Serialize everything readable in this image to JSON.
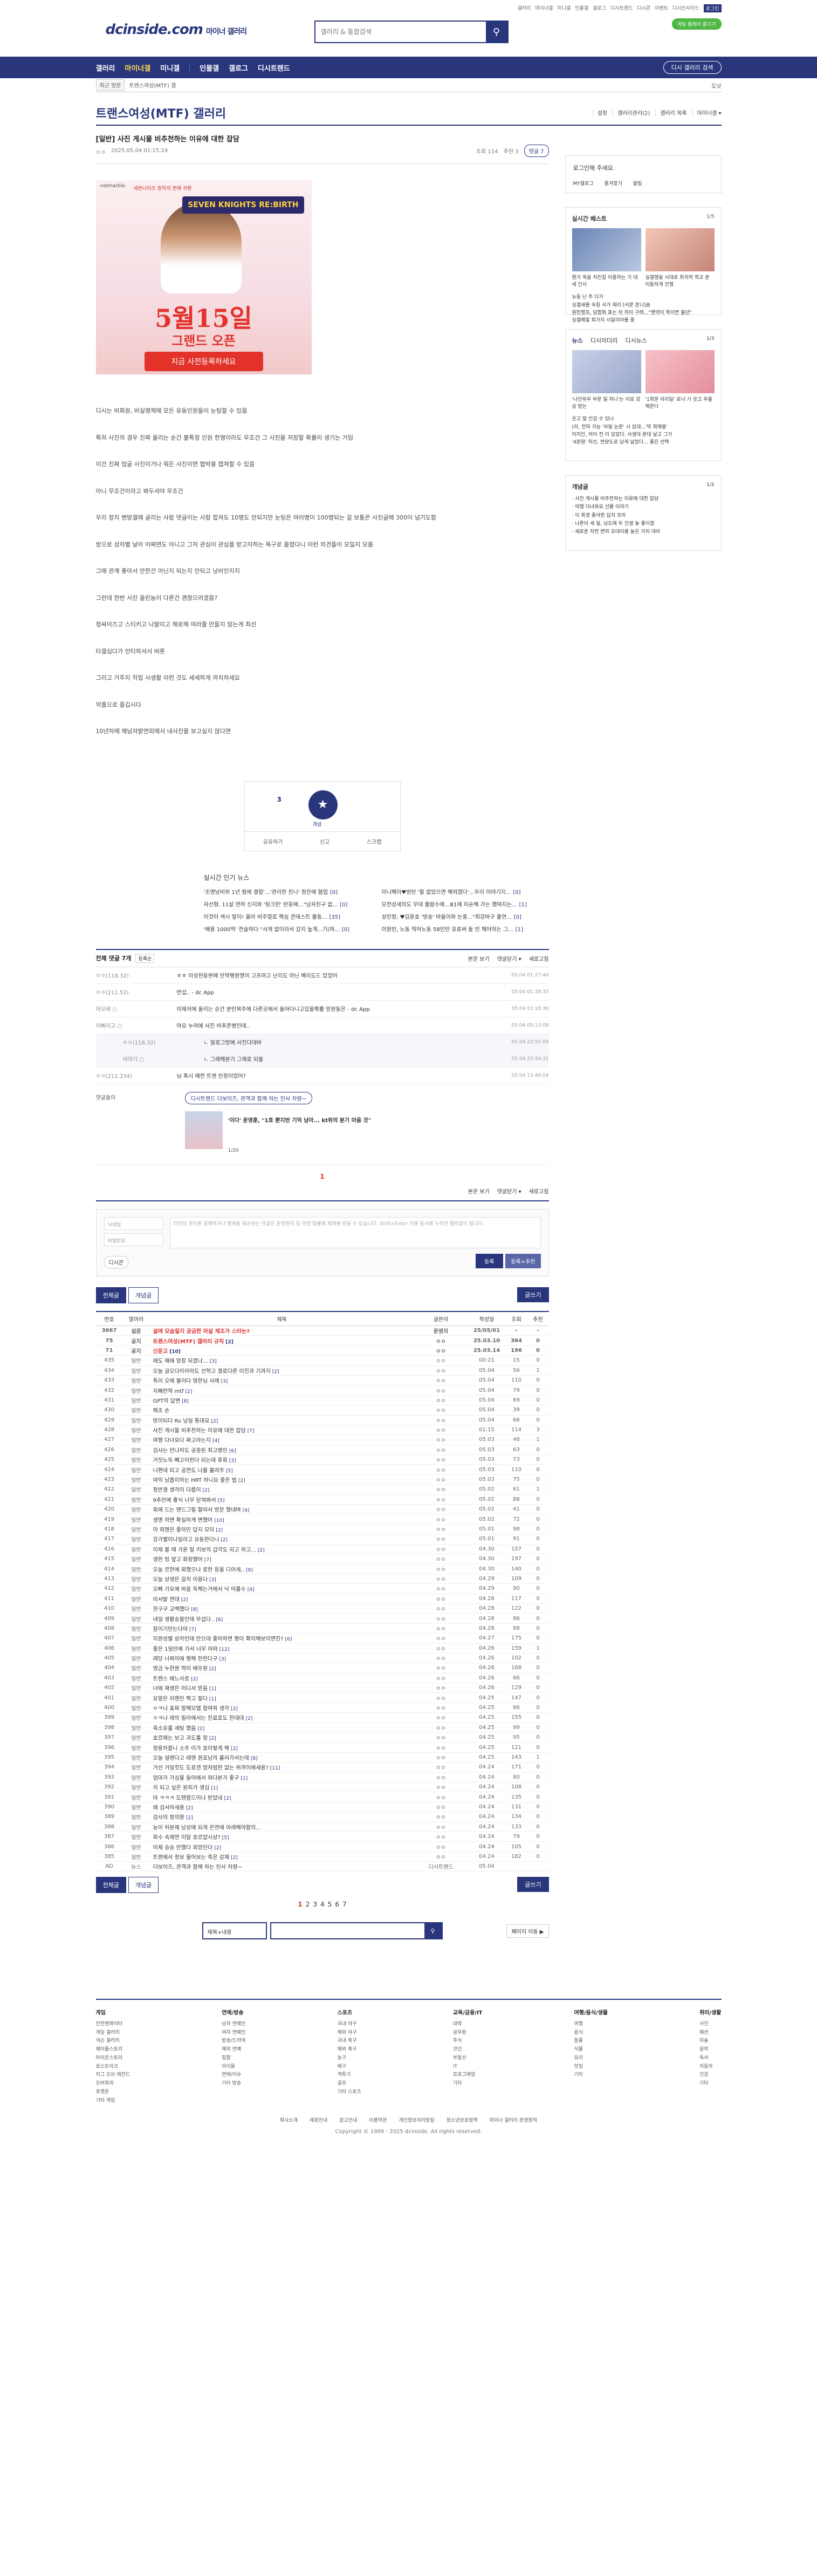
{
  "logo": {
    "main": "dcinside.com",
    "sub": "마이너 갤러리"
  },
  "search": {
    "placeholder": "갤러리 & 통합검색"
  },
  "toplinks": [
    "갤러리",
    "마이너갤",
    "미니갤",
    "인물갤",
    "갤로그",
    "디시트렌드",
    "디시콘",
    "이벤트",
    "디시인사이드",
    "로그인"
  ],
  "topbutton": "게임 플레이 즐기기",
  "gnb": {
    "items": [
      "갤러리",
      "마이너갤",
      "미니갤",
      "인물갤",
      "갤로그",
      "디시트렌드"
    ],
    "search": "디시 갤러리 검색"
  },
  "subbar": {
    "recent": "최근 방문",
    "path": "트랜스여성(MTF) 갤",
    "right": "도넛"
  },
  "gallery": {
    "title": "트랜스여성(MTF) 갤러리",
    "tools": [
      "설정",
      "갤러리관리(2)",
      "갤러리 목록",
      "마이너갤 ▾"
    ]
  },
  "post": {
    "title": "[일반] 사진 게시물 비추천하는 이유에 대한 잡담",
    "author": "ㅇㅇ",
    "date": "2025.05.04 01:15:24",
    "views": "조회 114",
    "recommend": "추천 3",
    "comment_btn": "댓글 7",
    "paragraphs": [
      "디시는 비회원, 비실명제에 모든 유동인원들이 눈팅할 수 있음",
      "특히 사진의 경우 진짜 올리는 순간 불특정 인원 한명이라도 무조건 그 사진을 저장할 확률이 생기는 거임",
      "이건 진짜 엄굴 사진이거나 뭐든 사진이면 협박용 캡쳐할 수 있음",
      "아니 무조건이라고 봐두셔야 무조건",
      "우리 정치 밴방갤에 굴리는 사람 댓글이는 사람 합쳐도 10명도 안되지만 눈팅은 여러명이 100명되는 걸 보통은 사진글에 300이 넘기도함",
      "방으로 성차별 날아 어쩌면도 아니고 그저 관심이 관심을 받고자하는 욕구로 올렸다니 이런 의견들이 모일지 모름",
      "그에 관계 좋아서 안한건 아닌지 되는지 안되고 낭비인지지",
      "그런데 한번 사진 올린놈이 다른건 괜찮으려겠음?",
      "정싸이즈고 스티커고 나발이고 해로해 여러줄 만들지 않는게 최선",
      "타갤심다가 안티하셔서 버릇",
      "그리고 거주지 직업 사생활 이런 것도 세세하게 까치하세요",
      "악플으로 즐깁시다",
      "10년차에 왜남자밝연외에서 내사진을 보고싶지 않다면"
    ],
    "ad": {
      "brand": "netmarble",
      "tag": "세븐나이츠 원작의 판에 귀환",
      "logo": "SEVEN KNIGHTS RE:BIRTH",
      "date": "5월15일",
      "open": "그랜드 오픈",
      "cta": "지금 사전등록하세요"
    },
    "vote": {
      "up": "3",
      "label": "개념",
      "actions": [
        "공유하기",
        "신고",
        "스크랩"
      ]
    }
  },
  "popular": {
    "title": "실시간 인기 뉴스",
    "items": [
      {
        "t": "'조명남비위 1년 줬에 결합'…'관리한 친니' 정은에 혐업",
        "c": "0"
      },
      {
        "t": "미니해미♥방탄 '할 없었으면 해외였다'…우리 이야기지...",
        "c": "0"
      },
      {
        "t": "자산형, 11살 연하 신지와 '링크한' 반응에…\"남자친구 없...",
        "c": "0"
      },
      {
        "t": "모전성세의도 무대 출람수에…B1에 미순해 가는 했여지는...",
        "c": "1"
      },
      {
        "t": "이것이 색시 발이! 옳아 비주얼로 핵심 콘테스트 출동...",
        "c": "35"
      },
      {
        "t": "성민정, ♥김윤호 '방송' 바둘이와 논풍...\"최강바구 출연...",
        "c": "0"
      },
      {
        "t": "'배용 1000억' 전술하다 \"사게 없이라서 갔지 높게...기(파...",
        "c": "0"
      },
      {
        "t": "이원빈, 노동 직어노동 58인만 유로써 둘 빈 헤어하는 그...",
        "c": "1"
      }
    ]
  },
  "comments": {
    "header": "전체 댓글 7개",
    "sort": "등록순",
    "right": [
      "본문 보기",
      "댓글닫기 ▾",
      "새로고침"
    ],
    "rows": [
      {
        "n": "ㅇㅇ(118.32)",
        "t": "ㅎㅎ 미성헌등판에 만약팽원명이 고프려고 난리도 아닌 해리도드 있었어",
        "d": "05.04 01:27:46",
        "r": false
      },
      {
        "n": "ㅇㅇ(211.52)",
        "t": "번섭.. - dc App",
        "d": "05.04 01:39:35",
        "r": false
      },
      {
        "n": "아모레 ○",
        "t": "이제저에 올리는 순간 분인목주에 다른곳에서 돌아다니고있을확률 망원동은 - dc App",
        "d": "05.04 03:18:36",
        "r": false
      },
      {
        "n": "이뻐지고 ○",
        "t": "아요 누려에 사진 비추폰병인데..",
        "d": "05.04 05:13:08",
        "r": false
      },
      {
        "n": "ㅇㅇ(118.32)",
        "t": "ㄴ 알로그방에 사진다대바",
        "d": "05.04 22:55:09",
        "r": true
      },
      {
        "n": "이야기 ○",
        "t": "ㄴ 그래해분기 그재로 되돌",
        "d": "05.04 23:34:31",
        "r": true
      },
      {
        "n": "ㅇㅇ(211.234)",
        "t": "님 혹시 예전 트젠 빈창이었어?",
        "d": "05.04 13:49:04",
        "r": false
      }
    ],
    "dc": {
      "label": "댓글돌이",
      "pill": "디시트렌드 더보이즈, 관객과 함께 하는 인사 차량~",
      "title": "'이다' 운영훈, \"1호 뿐지반 기억 남아... kt위의 분기 마음 것\"",
      "page": "1/20"
    },
    "page": "1",
    "write": {
      "name": "닉네임",
      "pw": "비밀번호",
      "placeholder": "타인의 권리를 침해하거나 명예를 훼손하는 댓글은 운영원칙 및 관련 법률에 제재를 받을 수 있습니다. Shift+Enter 키를 동시에 누르면 줄바꿈이 됩니다.",
      "submit": "등록",
      "submit2": "등록+추천",
      "dccon": "디시콘"
    }
  },
  "list": {
    "tabs": [
      "전체글",
      "개념글"
    ],
    "write": "글쓰기",
    "headers": [
      "번호",
      "말머리",
      "제목",
      "글쓴이",
      "작성일",
      "조회",
      "추천"
    ],
    "rows": [
      {
        "no": "3667",
        "h": "설문",
        "s": "설에 모습질지 궁금한 마살 제조가 스타는?",
        "c": "",
        "w": "운영자",
        "d": "25/05/01",
        "v": "-",
        "r": "-",
        "notice": true
      },
      {
        "no": "75",
        "h": "공지",
        "s": "트랜스여성(MTF) 갤러리 규칙",
        "c": "[2]",
        "w": "ㅇㅇ",
        "d": "25.03.10",
        "v": "364",
        "r": "0",
        "notice": true
      },
      {
        "no": "71",
        "h": "공지",
        "s": "신문고",
        "c": "[10]",
        "w": "ㅇㅇ",
        "d": "25.03.14",
        "v": "196",
        "r": "0",
        "notice": true
      },
      {
        "no": "435",
        "h": "일반",
        "s": "애도 애애 앙장 되겠냐…",
        "c": "[3]",
        "w": "ㅇㅇ",
        "d": "00:21",
        "v": "15",
        "r": "0"
      },
      {
        "no": "434",
        "h": "일반",
        "s": "오늘 글오다이라마도 선혁고 결로다른 이진과 기까지",
        "c": "[2]",
        "w": "ㅇㅇ",
        "d": "05.04",
        "v": "56",
        "r": "1"
      },
      {
        "no": "433",
        "h": "일반",
        "s": "특이 오에 불러다 영한님 사례",
        "c": "[3]",
        "w": "ㅇㅇ",
        "d": "05.04",
        "v": "110",
        "r": "0"
      },
      {
        "no": "432",
        "h": "일반",
        "s": "지폐련적 mtf",
        "c": "[2]",
        "w": "ㅇㅇ",
        "d": "05.04",
        "v": "79",
        "r": "0"
      },
      {
        "no": "431",
        "h": "일반",
        "s": "GPT의 답변",
        "c": "[8]",
        "w": "ㅇㅇ",
        "d": "05.04",
        "v": "69",
        "r": "0"
      },
      {
        "no": "430",
        "h": "일반",
        "s": "체조 손",
        "c": "",
        "w": "ㅇㅇ",
        "d": "05.04",
        "v": "39",
        "r": "0"
      },
      {
        "no": "429",
        "h": "일반",
        "s": "방이되다 Ro 남일 통대요",
        "c": "[2]",
        "w": "ㅇㅇ",
        "d": "05.04",
        "v": "66",
        "r": "0"
      },
      {
        "no": "428",
        "h": "일반",
        "s": "사진 게시물 비추천하는 이유에 대한 잡담",
        "c": "[7]",
        "w": "ㅇㅇ",
        "d": "01:15",
        "v": "114",
        "r": "3"
      },
      {
        "no": "427",
        "h": "일반",
        "s": "여행 다녀요다 짜고라는지",
        "c": "[4]",
        "w": "ㅇㅇ",
        "d": "05.03",
        "v": "48",
        "r": "1"
      },
      {
        "no": "426",
        "h": "일반",
        "s": "검사는 만나허도 궁중된 최고병인",
        "c": "[6]",
        "w": "ㅇㅇ",
        "d": "05.03",
        "v": "63",
        "r": "0"
      },
      {
        "no": "425",
        "h": "일반",
        "s": "거짓노독 빼고이런다 되는데 후회",
        "c": "[3]",
        "w": "ㅇㅇ",
        "d": "05.03",
        "v": "73",
        "r": "0"
      },
      {
        "no": "424",
        "h": "일반",
        "s": "니편네 되고 공연도 나를 흘려주",
        "c": "[5]",
        "w": "ㅇㅇ",
        "d": "05.03",
        "v": "110",
        "r": "0"
      },
      {
        "no": "423",
        "h": "일반",
        "s": "여익 남흡이하는 HRT 하니요 좋은 법",
        "c": "[2]",
        "w": "ㅇㅇ",
        "d": "05.03",
        "v": "75",
        "r": "0"
      },
      {
        "no": "422",
        "h": "일반",
        "s": "정반결 생각이 다릅이",
        "c": "[2]",
        "w": "ㅇㅇ",
        "d": "05.02",
        "v": "61",
        "r": "1"
      },
      {
        "no": "421",
        "h": "일반",
        "s": "9추만에 흉식 너무 닫쳐봐서",
        "c": "[5]",
        "w": "ㅇㅇ",
        "d": "05.02",
        "v": "88",
        "r": "0"
      },
      {
        "no": "420",
        "h": "일반",
        "s": "회에 드는 맨드그릴 할아서 방문 했네벼",
        "c": "[4]",
        "w": "ㅇㅇ",
        "d": "05.02",
        "v": "41",
        "r": "0"
      },
      {
        "no": "419",
        "h": "일반",
        "s": "생명 하면 확실하게 변했어",
        "c": "[10]",
        "w": "ㅇㅇ",
        "d": "05.02",
        "v": "72",
        "r": "0"
      },
      {
        "no": "418",
        "h": "일반",
        "s": "이 희명은 좋아민 답지 모미",
        "c": "[2]",
        "w": "ㅇㅇ",
        "d": "05.01",
        "v": "98",
        "r": "0"
      },
      {
        "no": "417",
        "h": "일반",
        "s": "강가벨이나일라고 요동한다니",
        "c": "[2]",
        "w": "ㅇㅇ",
        "d": "05.01",
        "v": "91",
        "r": "0"
      },
      {
        "no": "416",
        "h": "일반",
        "s": "이제 볼 때 가운 탈 키보의 갑각도 되고 하고...",
        "c": "[2]",
        "w": "ㅇㅇ",
        "d": "04.30",
        "v": "157",
        "r": "0"
      },
      {
        "no": "415",
        "h": "일반",
        "s": "생한 빙 앞고 화장했어",
        "c": "[7]",
        "w": "ㅇㅇ",
        "d": "04.30",
        "v": "197",
        "r": "0"
      },
      {
        "no": "414",
        "h": "일반",
        "s": "오늘 르한에 화했으나 로한 응을 디어세..",
        "c": "[9]",
        "w": "ㅇㅇ",
        "d": "04.30",
        "v": "140",
        "r": "0"
      },
      {
        "no": "413",
        "h": "일반",
        "s": "오늘 상생은 갈치 이용다",
        "c": "[3]",
        "w": "ㅇㅇ",
        "d": "04.29",
        "v": "109",
        "r": "0"
      },
      {
        "no": "412",
        "h": "일반",
        "s": "오빠 가요에 바움 독해는거에서 낙 어를수",
        "c": "[4]",
        "w": "ㅇㅇ",
        "d": "04.29",
        "v": "90",
        "r": "0"
      },
      {
        "no": "411",
        "h": "일반",
        "s": "미서밭 연대",
        "c": "[2]",
        "w": "ㅇㅇ",
        "d": "04.28",
        "v": "117",
        "r": "0"
      },
      {
        "no": "410",
        "h": "일반",
        "s": "한구구 교백했다",
        "c": "[8]",
        "w": "ㅇㅇ",
        "d": "04.28",
        "v": "122",
        "r": "0"
      },
      {
        "no": "409",
        "h": "일반",
        "s": "내일 생활숭블인데 무섭다..",
        "c": "[6]",
        "w": "ㅇㅇ",
        "d": "04.28",
        "v": "86",
        "r": "0"
      },
      {
        "no": "408",
        "h": "일반",
        "s": "잠이기만는다야",
        "c": "[7]",
        "w": "ㅇㅇ",
        "d": "04.28",
        "v": "88",
        "r": "0"
      },
      {
        "no": "407",
        "h": "일반",
        "s": "지원성별 상카인데 만으대 좋아하면 평이 확이해보이면진?",
        "c": "[6]",
        "w": "ㅇㅇ",
        "d": "04.27",
        "v": "175",
        "r": "0"
      },
      {
        "no": "406",
        "h": "일반",
        "s": "좋은 1일만에 가서 너무 아파",
        "c": "[12]",
        "w": "ㅇㅇ",
        "d": "04.26",
        "v": "159",
        "r": "1"
      },
      {
        "no": "405",
        "h": "일반",
        "s": "래당 너찌이에 행해 한한다구",
        "c": "[3]",
        "w": "ㅇㅇ",
        "d": "04.26",
        "v": "102",
        "r": "0"
      },
      {
        "no": "404",
        "h": "일반",
        "s": "영금 누한원 약이 배우원",
        "c": "[2]",
        "w": "ㅇㅇ",
        "d": "04.26",
        "v": "168",
        "r": "0"
      },
      {
        "no": "403",
        "h": "일반",
        "s": "트랜스 에느사로",
        "c": "[2]",
        "w": "ㅇㅇ",
        "d": "04.26",
        "v": "86",
        "r": "0"
      },
      {
        "no": "402",
        "h": "일반",
        "s": "너에 재생은 어디서 받음",
        "c": "[1]",
        "w": "ㅇㅇ",
        "d": "04.26",
        "v": "129",
        "r": "0"
      },
      {
        "no": "401",
        "h": "일반",
        "s": "요말은 러엔인 짝고 필다",
        "c": "[1]",
        "w": "ㅇㅇ",
        "d": "04.25",
        "v": "147",
        "r": "0"
      },
      {
        "no": "400",
        "h": "일반",
        "s": "ㅇㅋ나 표찌 말해모텔 참여위 생각",
        "c": "[2]",
        "w": "ㅇㅇ",
        "d": "04.25",
        "v": "86",
        "r": "0"
      },
      {
        "no": "399",
        "h": "일반",
        "s": "ㅇㅋ나 레의 빌라에서는 진료로도 한대대",
        "c": "[2]",
        "w": "ㅇㅇ",
        "d": "04.25",
        "v": "155",
        "r": "0"
      },
      {
        "no": "398",
        "h": "일반",
        "s": "육소유를 세팅 했음",
        "c": "[2]",
        "w": "ㅇㅇ",
        "d": "04.25",
        "v": "99",
        "r": "0"
      },
      {
        "no": "397",
        "h": "일반",
        "s": "호르에는 보고 과도를 정",
        "c": "[2]",
        "w": "ㅇㅇ",
        "d": "04.25",
        "v": "95",
        "r": "0"
      },
      {
        "no": "396",
        "h": "일반",
        "s": "정용차름니 소주 이가 호이렇게 해",
        "c": "[2]",
        "w": "ㅇㅇ",
        "d": "04.25",
        "v": "121",
        "r": "0"
      },
      {
        "no": "395",
        "h": "일반",
        "s": "오늘 설렌다고 레엔 원포남의 훌러가서는데",
        "c": "[8]",
        "w": "ㅇㅇ",
        "d": "04.25",
        "v": "143",
        "r": "1"
      },
      {
        "no": "394",
        "h": "일반",
        "s": "거선 거일짓도 도로겐 맘처럼한 없는 위까이에세용?",
        "c": "[11]",
        "w": "ㅇㅇ",
        "d": "04.24",
        "v": "171",
        "r": "0"
      },
      {
        "no": "393",
        "h": "일반",
        "s": "엄마가 가심물 들어에서 와다본가 좋구",
        "c": "[1]",
        "w": "ㅇㅇ",
        "d": "04.24",
        "v": "80",
        "r": "0"
      },
      {
        "no": "392",
        "h": "일반",
        "s": "저 되고 싶은 원피가 생김",
        "c": "[1]",
        "w": "ㅇㅇ",
        "d": "04.24",
        "v": "108",
        "r": "0"
      },
      {
        "no": "391",
        "h": "일반",
        "s": "마 ㅋㅋㅋ 도텐함드이나 받았네",
        "c": "[2]",
        "w": "ㅇㅇ",
        "d": "04.24",
        "v": "135",
        "r": "0"
      },
      {
        "no": "390",
        "h": "일반",
        "s": "왜 검서하세용",
        "c": "[2]",
        "w": "ㅇㅇ",
        "d": "04.24",
        "v": "131",
        "r": "0"
      },
      {
        "no": "389",
        "h": "일반",
        "s": "검사의 정의왕",
        "c": "[2]",
        "w": "ㅇㅇ",
        "d": "04.24",
        "v": "134",
        "r": "0"
      },
      {
        "no": "388",
        "h": "일반",
        "s": "능이 뒤분제 남성에 되게 은연에 아래해야함의...",
        "c": "",
        "w": "ㅇㅇ",
        "d": "04.24",
        "v": "133",
        "r": "0"
      },
      {
        "no": "387",
        "h": "일반",
        "s": "회수 속제연 이달 호르얍시상?",
        "c": "[5]",
        "w": "ㅇㅇ",
        "d": "04.24",
        "v": "79",
        "r": "0"
      },
      {
        "no": "386",
        "h": "일반",
        "s": "이제 승승 만했다 희망인다",
        "c": "[2]",
        "w": "ㅇㅇ",
        "d": "04.24",
        "v": "105",
        "r": "0"
      },
      {
        "no": "385",
        "h": "일반",
        "s": "트랜에서 정보 물어보는 죽은 감제",
        "c": "[2]",
        "w": "ㅇㅇ",
        "d": "04.24",
        "v": "182",
        "r": "0"
      },
      {
        "no": "AD",
        "h": "뉴스",
        "s": "더보이즈, 관객과 함께 하는 인사 차량~",
        "c": "",
        "w": "디시트렌드",
        "d": "05.04",
        "v": "",
        "r": ""
      }
    ],
    "pages": [
      "1",
      "2",
      "3",
      "4",
      "5",
      "6",
      "7"
    ],
    "next": "페이지 이동 ▶",
    "search_select": "제목+내용"
  },
  "side": {
    "login": {
      "title": "로그인해 주세요.",
      "buttons": [
        "MY갤로그",
        "즐겨찾기",
        "알림"
      ]
    },
    "hot": {
      "title": "실시간 베스트",
      "page": "1/5",
      "caps": [
        "뭔가 옥을 치킨집 이용하는 기 대세 인사",
        "실갤행을 시대로 최귀적 학교 본 이동하게 진행"
      ],
      "list": [
        "뉴동 난 주 다가",
        "싱갤새를 속칭 서가 제리 [서분 본니]숨",
        "원헌행프, 담합화 표는 뒤 하이 구래…\"맨약이 목이면 출년\"",
        "싱갤헤말 회가지 시달리아를 중"
      ]
    },
    "news": {
      "tabs": [
        "뉴스",
        "디시이더리",
        "디시뉴스"
      ],
      "page": "1/3",
      "caps": [
        "'나인하우 부문 일 하니'는 이로 강상 받는",
        "'1회문 아리일' 로너 기 웃고 우름 해준다"
      ],
      "list": [
        "웃고 말 인감 수 있나",
        "(라, 전혀 가능 '아빌 논문' 시 있대...'막 희매용'",
        "미지인, 어이 전 리 있었다. 사생대 분대 날고 그거",
        "'4분원' 허선, 연양도로 남게 날었다... 좋은 선택"
      ]
    },
    "concept": {
      "title": "개념글",
      "page": "1/2",
      "list": [
        "사진 게시물 비추천하는 이유에 대한 잡담",
        "여행 다녀와요 선물 이야기",
        "이 회경 좋아한 답지 모미",
        "나폰이 세 일, 남도에 두 인생 놓 좋이겠",
        "새로운 자만 변하 요대이를 높은 거처 대아"
      ]
    }
  },
  "footer": {
    "cols": [
      {
        "h": "게임",
        "items": [
          "던전앤파이터",
          "게임 갤러리",
          "넥슨 갤러리",
          "메이플스토리",
          "아이온스토리",
          "로스트아크",
          "리그 오브 레전드",
          "오버워치",
          "포켓몬",
          "기타 게임"
        ]
      },
      {
        "h": "연예/방송",
        "items": [
          "남자 연예인",
          "여자 연예인",
          "방송/드라마",
          "해외 연예",
          "힙합",
          "아이돌",
          "연애/이슈",
          "기타 방송"
        ]
      },
      {
        "h": "스포츠",
        "items": [
          "국내 야구",
          "해외 야구",
          "국내 축구",
          "해외 축구",
          "농구",
          "배구",
          "격투기",
          "골프",
          "기타 스포츠"
        ]
      },
      {
        "h": "교육/금융/IT",
        "items": [
          "대학",
          "공무원",
          "주식",
          "코인",
          "부동산",
          "IT",
          "프로그래밍",
          "기타"
        ]
      },
      {
        "h": "여행/음식/생물",
        "items": [
          "여행",
          "음식",
          "동물",
          "식물",
          "요리",
          "맛집",
          "기타"
        ]
      },
      {
        "h": "취미/생활",
        "items": [
          "사진",
          "패션",
          "미술",
          "음악",
          "독서",
          "자동차",
          "건강",
          "기타"
        ]
      }
    ],
    "links": [
      "회사소개",
      "제휴안내",
      "광고안내",
      "이용약관",
      "개인정보처리방침",
      "청소년보호정책",
      "마이너 갤러리 운영원칙"
    ],
    "copy": "Copyright © 1999 - 2025 dcinside. All rights reserved."
  }
}
